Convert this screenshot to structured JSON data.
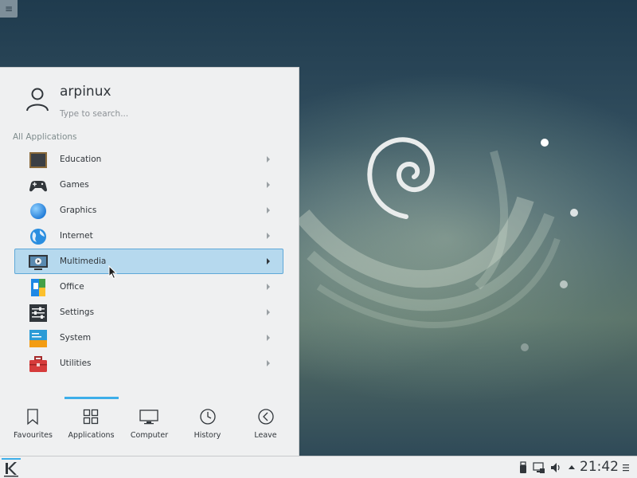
{
  "user": {
    "name": "arpinux"
  },
  "search": {
    "placeholder": "Type to search..."
  },
  "section": {
    "title": "All Applications"
  },
  "apps": [
    {
      "label": "Education",
      "icon": "chalkboard-icon"
    },
    {
      "label": "Games",
      "icon": "gamepad-icon"
    },
    {
      "label": "Graphics",
      "icon": "graphics-sphere-icon"
    },
    {
      "label": "Internet",
      "icon": "globe-icon"
    },
    {
      "label": "Multimedia",
      "icon": "monitor-play-icon",
      "selected": true
    },
    {
      "label": "Office",
      "icon": "office-document-icon"
    },
    {
      "label": "Settings",
      "icon": "sliders-icon"
    },
    {
      "label": "System",
      "icon": "system-icon"
    },
    {
      "label": "Utilities",
      "icon": "toolbox-icon"
    }
  ],
  "tabs": [
    {
      "label": "Favourites",
      "icon": "bookmark-icon"
    },
    {
      "label": "Applications",
      "icon": "grid-icon",
      "active": true
    },
    {
      "label": "Computer",
      "icon": "computer-icon"
    },
    {
      "label": "History",
      "icon": "clock-icon"
    },
    {
      "label": "Leave",
      "icon": "back-circle-icon"
    }
  ],
  "taskbar": {
    "clock": "21:42"
  },
  "colors": {
    "accent": "#3daee9",
    "selection": "#b6d9ee",
    "panel": "#eff0f1"
  }
}
